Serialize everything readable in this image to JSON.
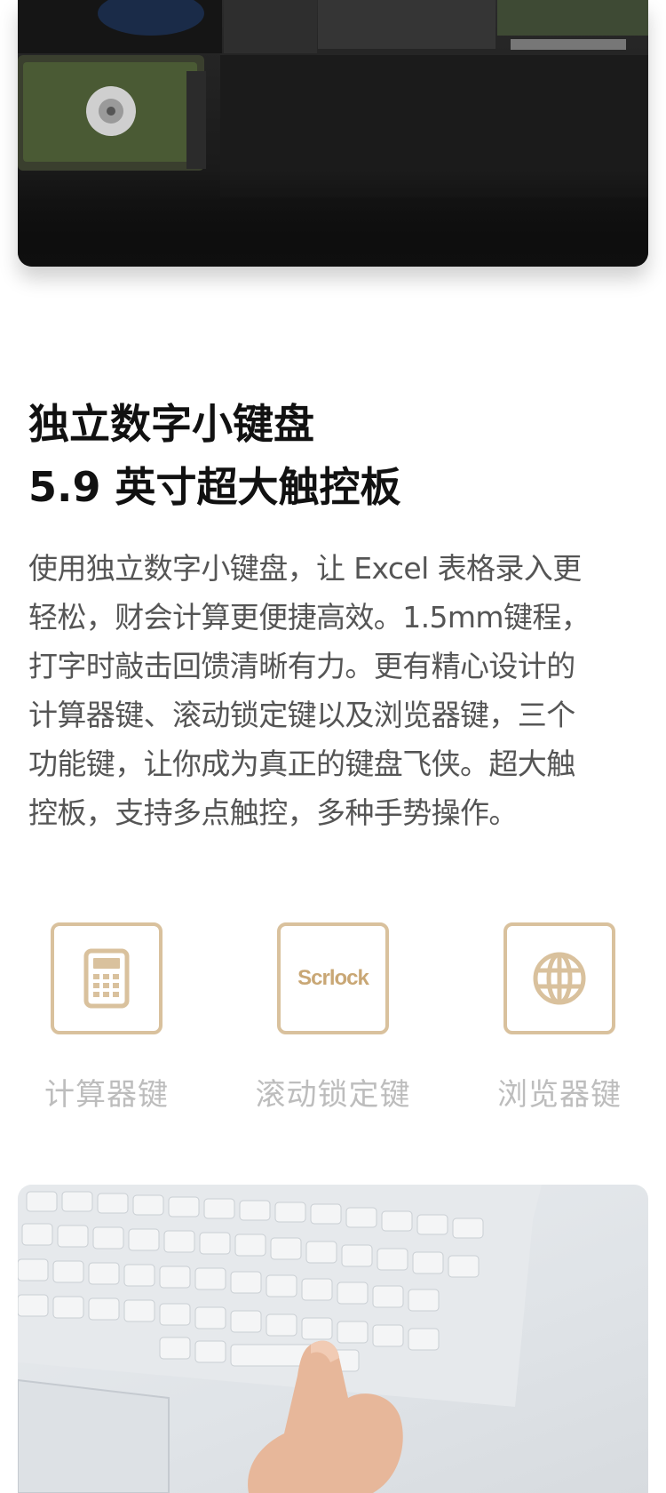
{
  "headline": {
    "line1": "独立数字小键盘",
    "line2": "5.9 英寸超大触控板"
  },
  "description": {
    "lines": [
      "使用独立数字小键盘，让 Excel 表格录入更",
      "轻松，财会计算更便捷高效。1.5mm键程，",
      "打字时敲击回馈清晰有力。更有精心设计的",
      "计算器键、滚动锁定键以及浏览器键，三个",
      "功能键，让你成为真正的键盘飞侠。超大触",
      "控板，支持多点触控，多种手势操作。"
    ]
  },
  "features": [
    {
      "icon": "calculator-icon",
      "label": "计算器键"
    },
    {
      "icon": "scrlock-icon",
      "icon_text": "Scrlock",
      "label": "滚动锁定键"
    },
    {
      "icon": "globe-icon",
      "label": "浏览器键"
    }
  ],
  "colors": {
    "accent": "#d9c19d",
    "label_gray": "#bdbdbd",
    "body_text": "#555555",
    "headline_text": "#111111"
  }
}
